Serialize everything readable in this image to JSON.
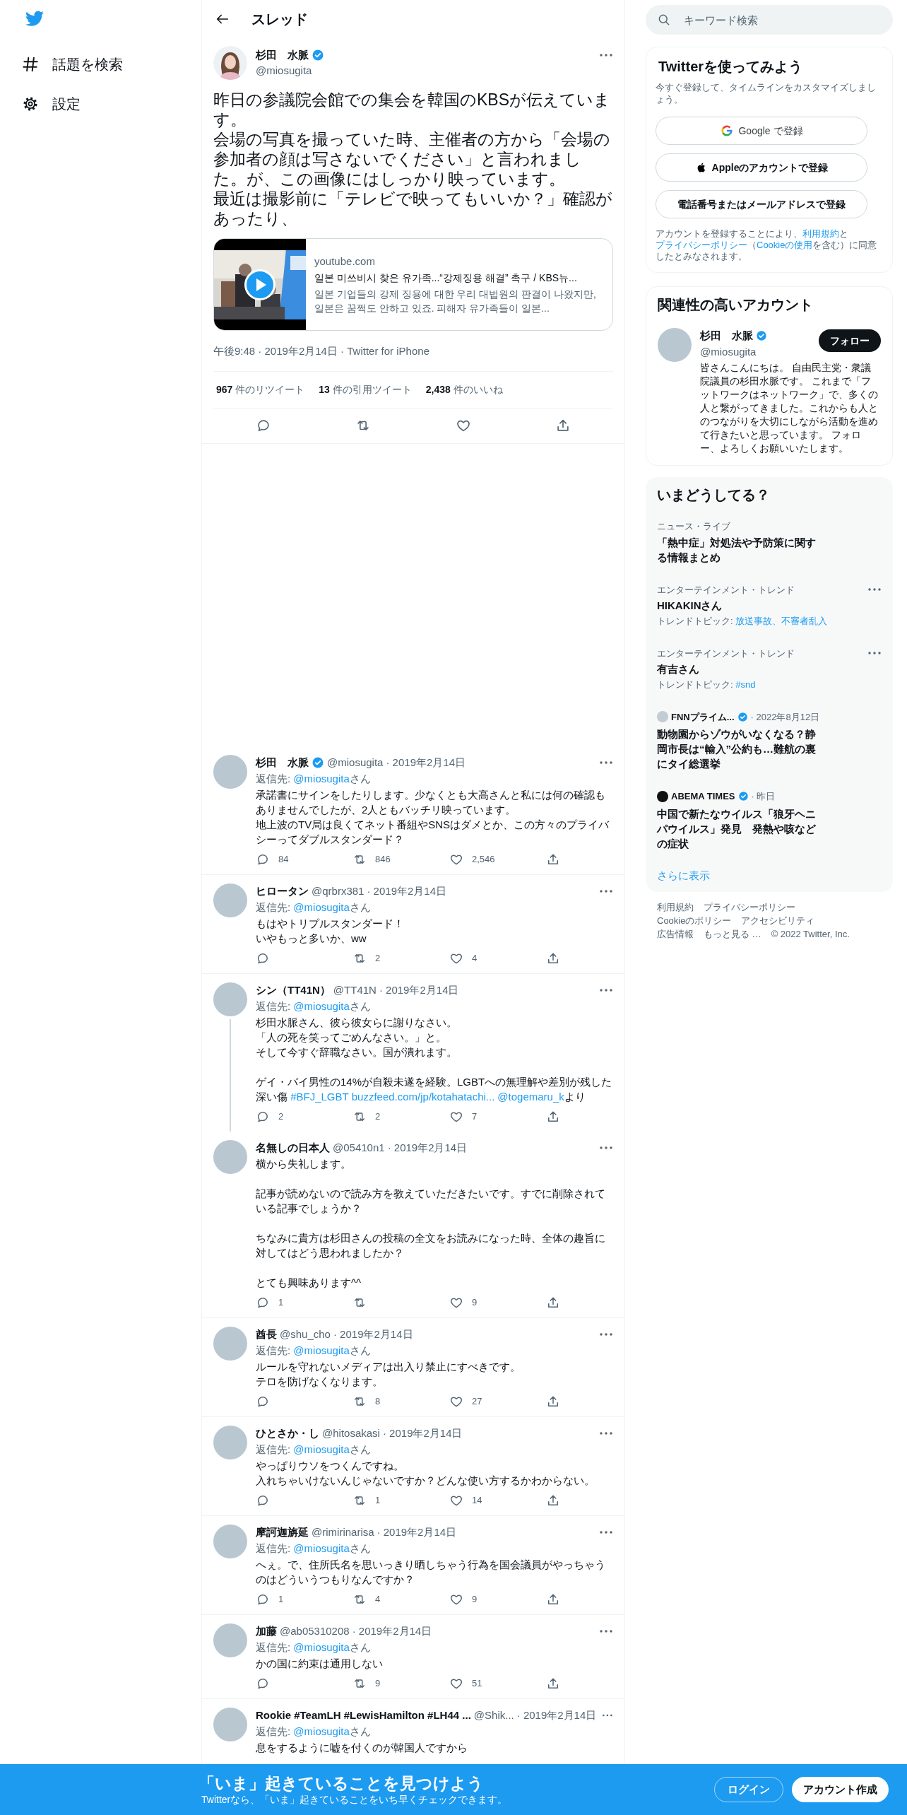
{
  "nav": {
    "items": [
      {
        "kind": "hash",
        "label": "話題を検索"
      },
      {
        "kind": "gear",
        "label": "設定"
      }
    ]
  },
  "header": {
    "title": "スレッド"
  },
  "main_tweet": {
    "name": "杉田　水脈",
    "verified": true,
    "handle": "@miosugita",
    "paragraphs": [
      "昨日の参議院会館での集会を韓国のKBSが伝えています。",
      "会場の写真を撮っていた時、主催者の方から「会場の参加者の顔は写さないでください」と言われました。が、この画像にはしっかり映っています。",
      "最近は撮影前に「テレビで映ってもいいか？」確認があったり、"
    ],
    "card": {
      "kind": "picture",
      "domain": "youtube.com",
      "title": "일본 미쓰비시 찾은 유가족...“강제징용 해결” 촉구 / KBS뉴...",
      "description": "일본 기업들의 강제 징용에 대한 우리 대법원의 판결이 나왔지만, 일본은 꿈쩍도 안하고 있죠. 피해자 유가족들이 일본..."
    },
    "meta": "午後9:48 · 2019年2月14日 · Twitter for iPhone",
    "stats": [
      {
        "count": "967",
        "label": "件のリツイート"
      },
      {
        "count": "13",
        "label": "件の引用ツイート"
      },
      {
        "count": "2,438",
        "label": "件のいいね"
      }
    ]
  },
  "replies": [
    {
      "name": "杉田　水脈",
      "verified": true,
      "handle": "@miosugita",
      "date": "· 2019年2月14日",
      "reply_label": "返信先:",
      "reply_to": "@miosugita",
      "reply_suffix": "さん",
      "thread": false,
      "lines": [
        {
          "kind": "text",
          "text": "承諾書にサインをしたりします。少なくとも大高さんと私には何の確認もありませんでしたが、2人ともバッチリ映っています。"
        },
        {
          "kind": "text",
          "text": "地上波のTV局は良くてネット番組やSNSはダメとか、この方々のプライバシーってダブルスタンダード？"
        }
      ],
      "counts": {
        "reply": "84",
        "retweet": "846",
        "like": "2,546"
      }
    },
    {
      "name": "ヒロータン",
      "verified": false,
      "handle": "@qrbrx381",
      "date": "· 2019年2月14日",
      "reply_label": "返信先:",
      "reply_to": "@miosugita",
      "reply_suffix": "さん",
      "thread": false,
      "lines": [
        {
          "kind": "text",
          "text": "もはやトリプルスタンダード！"
        },
        {
          "kind": "text",
          "text": "いやもっと多いか、ww"
        }
      ],
      "counts": {
        "retweet": "2",
        "like": "4"
      }
    },
    {
      "name": "シン（TT41N）",
      "verified": false,
      "handle": "@TT41N",
      "date": "· 2019年2月14日",
      "reply_label": "返信先:",
      "reply_to": "@miosugita",
      "reply_suffix": "さん",
      "thread": true,
      "lines": [
        {
          "kind": "text",
          "text": "杉田水脈さん、彼ら彼女らに謝りなさい。"
        },
        {
          "kind": "text",
          "text": "「人の死を笑ってごめんなさい。」と。"
        },
        {
          "kind": "text",
          "text": "そして今すぐ辞職なさい。国が潰れます。"
        },
        {
          "kind": "gap"
        },
        {
          "kind": "rich",
          "parts": [
            {
              "kind": "text",
              "text": "ゲイ・バイ男性の14%が自殺未遂を経験。LGBTへの無理解や差別が残した深い傷 "
            },
            {
              "kind": "link",
              "text": "#BFJ_LGBT"
            },
            {
              "kind": "link",
              "text": "buzzfeed.com/jp/kotahatachi..."
            },
            {
              "kind": "link",
              "text": "@togemaru_k"
            },
            {
              "kind": "text",
              "text": "より"
            }
          ]
        }
      ],
      "counts": {
        "reply": "2",
        "retweet": "2",
        "like": "7"
      }
    },
    {
      "name": "名無しの日本人",
      "verified": false,
      "handle": "@05410n1",
      "date": "· 2019年2月14日",
      "thread": false,
      "lines": [
        {
          "kind": "text",
          "text": "横から失礼します。"
        },
        {
          "kind": "gap"
        },
        {
          "kind": "text",
          "text": "記事が読めないので読み方を教えていただきたいです。すでに削除されている記事でしょうか？"
        },
        {
          "kind": "gap"
        },
        {
          "kind": "text",
          "text": "ちなみに貴方は杉田さんの投稿の全文をお読みになった時、全体の趣旨に対してはどう思われましたか？"
        },
        {
          "kind": "gap"
        },
        {
          "kind": "text",
          "text": "とても興味あります^^"
        }
      ],
      "counts": {
        "reply": "1",
        "like": "9"
      }
    },
    {
      "name": "酋長",
      "verified": false,
      "handle": "@shu_cho",
      "date": "· 2019年2月14日",
      "reply_label": "返信先:",
      "reply_to": "@miosugita",
      "reply_suffix": "さん",
      "thread": false,
      "lines": [
        {
          "kind": "text",
          "text": "ルールを守れないメディアは出入り禁止にすべきです。"
        },
        {
          "kind": "text",
          "text": "テロを防げなくなります。"
        }
      ],
      "counts": {
        "retweet": "8",
        "like": "27"
      }
    },
    {
      "name": "ひとさか・し",
      "verified": false,
      "handle": "@hitosakasi",
      "date": "· 2019年2月14日",
      "reply_label": "返信先:",
      "reply_to": "@miosugita",
      "reply_suffix": "さん",
      "thread": false,
      "lines": [
        {
          "kind": "text",
          "text": "やっぱりウソをつくんですね。"
        },
        {
          "kind": "text",
          "text": "入れちゃいけないんじゃないですか？どんな使い方するかわからない。"
        }
      ],
      "counts": {
        "retweet": "1",
        "like": "14"
      }
    },
    {
      "name": "摩訶迦旃延",
      "verified": false,
      "handle": "@rimirinarisa",
      "date": "· 2019年2月14日",
      "reply_label": "返信先:",
      "reply_to": "@miosugita",
      "reply_suffix": "さん",
      "thread": false,
      "lines": [
        {
          "kind": "text",
          "text": "へぇ。で、住所氏名を思いっきり晒しちゃう行為を国会議員がやっちゃうのはどういうつもりなんですか？"
        }
      ],
      "counts": {
        "reply": "1",
        "retweet": "4",
        "like": "9"
      }
    },
    {
      "name": "加藤",
      "verified": false,
      "handle": "@ab05310208",
      "date": "· 2019年2月14日",
      "reply_label": "返信先:",
      "reply_to": "@miosugita",
      "reply_suffix": "さん",
      "thread": false,
      "lines": [
        {
          "kind": "text",
          "text": "かの国に約束は通用しない"
        }
      ],
      "counts": {
        "retweet": "9",
        "like": "51"
      }
    },
    {
      "name": "Rookie #TeamLH #LewisHamilton #LH44 ...",
      "verified": false,
      "handle": "@Shik...",
      "date": "· 2019年2月14日",
      "reply_label": "返信先:",
      "reply_to": "@miosugita",
      "reply_suffix": "さん",
      "thread": false,
      "lines": [
        {
          "kind": "text",
          "text": "息をするように嘘を付くのが韓国人ですから"
        }
      ]
    }
  ],
  "search": {
    "placeholder": "キーワード検索"
  },
  "signup": {
    "title": "Twitterを使ってみよう",
    "subtitle": "今すぐ登録して、タイムラインをカスタマイズしましょう。",
    "buttons": [
      {
        "kind": "google",
        "label": "Google で登録"
      },
      {
        "kind": "apple",
        "label": "Appleのアカウントで登録"
      },
      {
        "kind": "plain",
        "label": "電話番号またはメールアドレスで登録"
      }
    ],
    "legal": [
      {
        "kind": "text",
        "text": "アカウントを登録することにより、"
      },
      {
        "kind": "link",
        "text": "利用規約"
      },
      {
        "kind": "text",
        "text": "と"
      },
      {
        "kind": "link",
        "text": "プライバシーポリシー"
      },
      {
        "kind": "text",
        "text": "（"
      },
      {
        "kind": "link",
        "text": "Cookieの使用"
      },
      {
        "kind": "text",
        "text": "を含む）に同意したとみなされます。"
      }
    ]
  },
  "related": {
    "title": "関連性の高いアカウント",
    "name": "杉田　水脈",
    "verified": true,
    "handle": "@miosugita",
    "follow": "フォロー",
    "bio": "皆さんこんにちは。 自由民主党・衆議院議員の杉田水脈です。 これまで「フットワークはネットワーク」で、多くの人と繋がってきました。これからも人とのつながりを大切にしながら活動を進めて行きたいと思っています。 フォロー、よろしくお願いいたします。"
  },
  "trends": {
    "title": "いまどうしてる？",
    "items": [
      {
        "kind": "topic",
        "category": "ニュース・ライブ",
        "title": "「熱中症」対処法や予防策に関する情報まとめ"
      },
      {
        "kind": "trend",
        "category": "エンターテインメント・トレンド",
        "title": "HIKAKINさん",
        "topics_label": "トレンドトピック:",
        "topics": "放送事故、不審者乱入"
      },
      {
        "kind": "trend",
        "category": "エンターテインメント・トレンド",
        "title": "有吉さん",
        "topics_label": "トレンドトピック:",
        "topics": "#snd"
      },
      {
        "kind": "news",
        "source": "FNNプライム...",
        "verified": true,
        "date": "· 2022年8月12日",
        "color": "#c4ccd3",
        "title": "動物園からゾウがいなくなる？静岡市長は“輸入”公約も…難航の裏にタイ総選挙"
      },
      {
        "kind": "news",
        "source": "ABEMA TIMES",
        "verified": true,
        "date": "· 昨日",
        "color": "#111111",
        "title": "中国で新たなウイルス「狼牙ヘニパウイルス」発見　発熱や咳などの症状"
      }
    ],
    "more": "さらに表示"
  },
  "footer": [
    "利用規約",
    "プライバシーポリシー",
    "Cookieのポリシー",
    "アクセシビリティ",
    "広告情報",
    "もっと見る …",
    "© 2022 Twitter, Inc."
  ],
  "banner": {
    "title": "「いま」起きていることを見つけよう",
    "subtitle": "Twitterなら、「いま」起きていることをいち早くチェックできます。",
    "buttons": [
      {
        "kind": "outline",
        "label": "ログイン"
      },
      {
        "kind": "filled",
        "label": "アカウント作成"
      }
    ]
  }
}
